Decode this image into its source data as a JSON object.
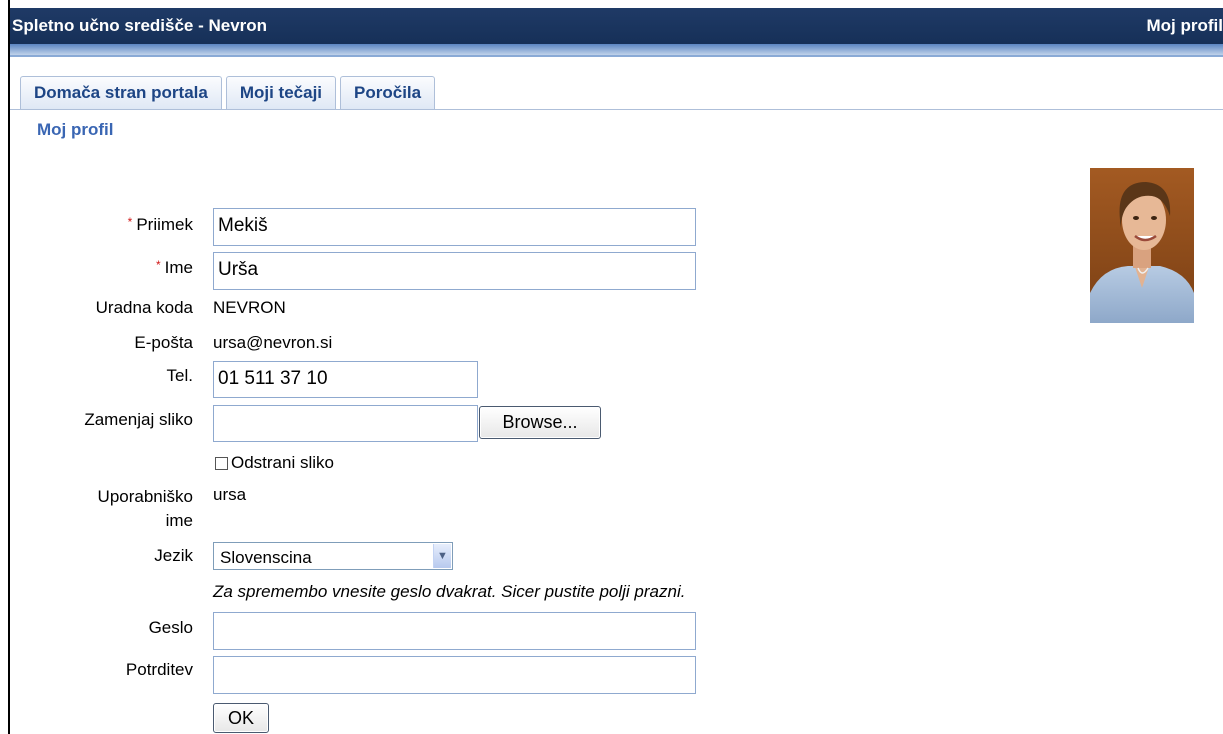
{
  "header": {
    "app_title": "Spletno učno središče - Nevron",
    "page_label": "Moj profil"
  },
  "tabs": [
    {
      "label": "Domača stran portala"
    },
    {
      "label": "Moji tečaji"
    },
    {
      "label": "Poročila"
    }
  ],
  "section_title": "Moj profil",
  "form": {
    "required_mark": "*",
    "surname": {
      "label": "Priimek",
      "value": "Mekiš"
    },
    "first_name": {
      "label": "Ime",
      "value": "Urša"
    },
    "official_code": {
      "label": "Uradna koda",
      "value": "NEVRON"
    },
    "email": {
      "label": "E-pošta",
      "value": "ursa@nevron.si"
    },
    "phone": {
      "label": "Tel.",
      "value": "01 511 37 10"
    },
    "replace_picture": {
      "label": "Zamenjaj sliko",
      "value": "",
      "browse_label": "Browse..."
    },
    "remove_picture": {
      "label": "Odstrani sliko",
      "checked": false
    },
    "username": {
      "label_line1": "Uporabniško",
      "label_line2": "ime",
      "value": "ursa"
    },
    "language": {
      "label": "Jezik",
      "selected": "Slovenscina"
    },
    "password_hint": "Za spremembo vnesite geslo dvakrat. Sicer pustite polji prazni.",
    "password": {
      "label": "Geslo",
      "value": ""
    },
    "confirm": {
      "label": "Potrditev",
      "value": ""
    },
    "ok_label": "OK"
  }
}
